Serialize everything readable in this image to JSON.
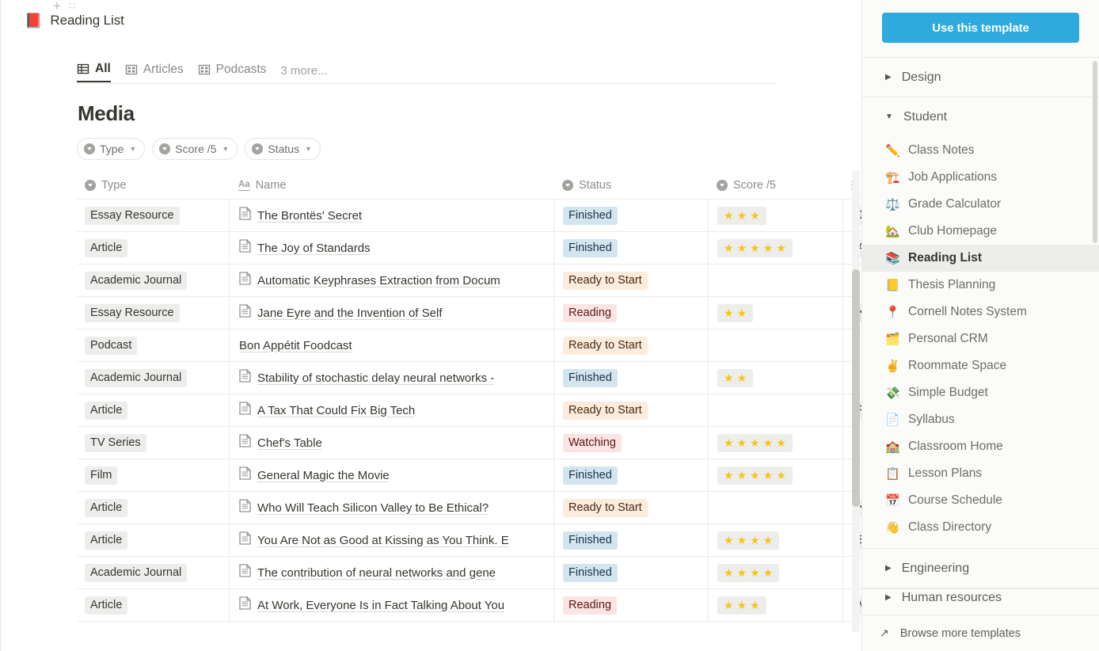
{
  "page": {
    "add_icon": "plus-icon",
    "drag_icon": "drag-handle-icon",
    "emoji": "📕",
    "title": "Reading List"
  },
  "tabs": [
    {
      "label": "All",
      "icon": "table-view-icon",
      "active": true
    },
    {
      "label": "Articles",
      "icon": "gallery-view-icon",
      "active": false
    },
    {
      "label": "Podcasts",
      "icon": "gallery-view-icon",
      "active": false
    }
  ],
  "tabs_more": "3 more...",
  "database": {
    "title": "Media",
    "filters": [
      {
        "label": "Type"
      },
      {
        "label": "Score /5"
      },
      {
        "label": "Status"
      }
    ],
    "columns": [
      {
        "key": "type",
        "label": "Type",
        "icon": "select-property-icon"
      },
      {
        "key": "name",
        "label": "Name",
        "icon": "title-property-icon"
      },
      {
        "key": "status",
        "label": "Status",
        "icon": "select-property-icon"
      },
      {
        "key": "score",
        "label": "Score /5",
        "icon": "select-property-icon"
      },
      {
        "key": "extra",
        "label": "",
        "icon": "multi-select-property-icon"
      }
    ],
    "rows": [
      {
        "type": "Essay Resource",
        "name": "The Brontës' Secret",
        "status": "Finished",
        "status_class": "s-finished",
        "score": 3,
        "extra": "Ju"
      },
      {
        "type": "Article",
        "name": "The Joy of Standards",
        "status": "Finished",
        "status_class": "s-finished",
        "score": 5,
        "extra": "Ar"
      },
      {
        "type": "Academic Journal",
        "name": "Automatic Keyphrases Extraction from Docum",
        "status": "Ready to Start",
        "status_class": "s-ready",
        "score": 0,
        "extra": ""
      },
      {
        "type": "Essay Resource",
        "name": "Jane Eyre and the Invention of Self",
        "status": "Reading",
        "status_class": "s-reading",
        "score": 2,
        "extra": "Ka"
      },
      {
        "type": "Podcast",
        "name": "Bon Appétit Foodcast",
        "status": "Ready to Start",
        "status_class": "s-ready",
        "score": 0,
        "extra": ""
      },
      {
        "type": "Academic Journal",
        "name": "Stability of stochastic delay neural networks - ",
        "status": "Finished",
        "status_class": "s-finished",
        "score": 2,
        "extra": ""
      },
      {
        "type": "Article",
        "name": "A Tax That Could Fix Big Tech",
        "status": "Ready to Start",
        "status_class": "s-ready",
        "score": 0,
        "extra": "Pa"
      },
      {
        "type": "TV Series",
        "name": "Chef's Table",
        "status": "Watching",
        "status_class": "s-watching",
        "score": 5,
        "extra": ""
      },
      {
        "type": "Film",
        "name": "General Magic the Movie",
        "status": "Finished",
        "status_class": "s-finished",
        "score": 5,
        "extra": ""
      },
      {
        "type": "Article",
        "name": "Who Will Teach Silicon Valley to Be Ethical?",
        "status": "Ready to Start",
        "status_class": "s-ready",
        "score": 0,
        "extra": "Ka"
      },
      {
        "type": "Article",
        "name": "You Are Not as Good at Kissing as You Think. E",
        "status": "Finished",
        "status_class": "s-finished",
        "score": 4,
        "extra": "Sp"
      },
      {
        "type": "Academic Journal",
        "name": "The contribution of neural networks and gene",
        "status": "Finished",
        "status_class": "s-finished",
        "score": 4,
        "extra": ""
      },
      {
        "type": "Article",
        "name": "At Work, Everyone Is in Fact Talking About You",
        "status": "Reading",
        "status_class": "s-reading",
        "score": 3,
        "extra": "M"
      }
    ]
  },
  "sidebar": {
    "use_template_label": "Use this template",
    "groups": [
      {
        "label": "Design",
        "expanded": false,
        "items": []
      },
      {
        "label": "Student",
        "expanded": true,
        "items": [
          {
            "emoji": "✏️",
            "label": "Class Notes",
            "selected": false
          },
          {
            "emoji": "🏗️",
            "label": "Job Applications",
            "selected": false
          },
          {
            "emoji": "⚖️",
            "label": "Grade Calculator",
            "selected": false
          },
          {
            "emoji": "🏡",
            "label": "Club Homepage",
            "selected": false
          },
          {
            "emoji": "📚",
            "label": "Reading List",
            "selected": true
          },
          {
            "emoji": "📒",
            "label": "Thesis Planning",
            "selected": false
          },
          {
            "emoji": "📍",
            "label": "Cornell Notes System",
            "selected": false
          },
          {
            "emoji": "🗂️",
            "label": "Personal CRM",
            "selected": false
          },
          {
            "emoji": "✌️",
            "label": "Roommate Space",
            "selected": false
          },
          {
            "emoji": "💸",
            "label": "Simple Budget",
            "selected": false
          },
          {
            "emoji": "📄",
            "label": "Syllabus",
            "selected": false
          },
          {
            "emoji": "🏫",
            "label": "Classroom Home",
            "selected": false
          },
          {
            "emoji": "📋",
            "label": "Lesson Plans",
            "selected": false
          },
          {
            "emoji": "📅",
            "label": "Course Schedule",
            "selected": false
          },
          {
            "emoji": "👋",
            "label": "Class Directory",
            "selected": false
          }
        ]
      },
      {
        "label": "Engineering",
        "expanded": false,
        "items": []
      },
      {
        "label": "Human resources",
        "expanded": false,
        "items": []
      }
    ],
    "browse_more_label": "Browse more templates",
    "browse_more_icon": "external-link-icon"
  },
  "colors": {
    "accent": "#2eaadc",
    "text": "#37352f",
    "muted": "#8d8c89",
    "finished_bg": "#d3e5ef",
    "ready_bg": "#fbecdd",
    "reading_bg": "#fbe4e4",
    "star": "#f5c518",
    "selected_bg": "#ededeb"
  }
}
